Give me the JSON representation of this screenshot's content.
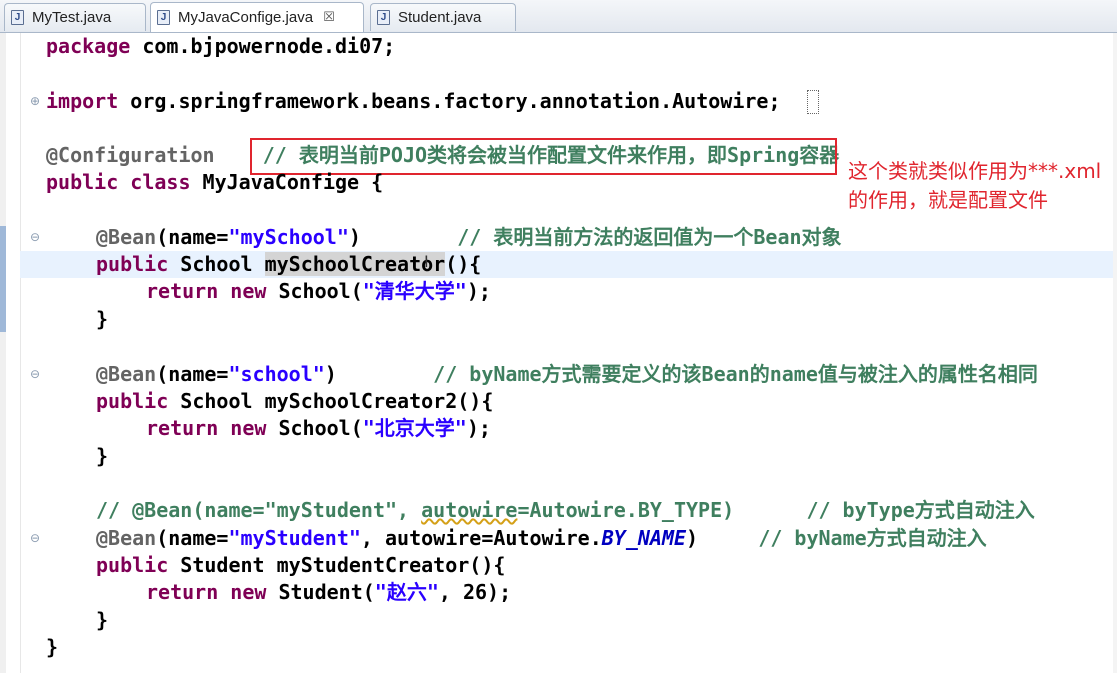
{
  "tabs": [
    {
      "label": "MyTest.java",
      "icon": "java-file-icon",
      "active": false
    },
    {
      "label": "MyJavaConfige.java",
      "icon": "java-file-icon",
      "active": true,
      "close": "☒"
    },
    {
      "label": "Student.java",
      "icon": "java-file-icon",
      "active": false
    }
  ],
  "code": {
    "l1": {
      "kw": "package",
      "rest": " com.bjpowernode.di07;"
    },
    "l3": {
      "kw": "import",
      "rest": " org.springframework.beans.factory.annotation.Autowire;"
    },
    "l5": {
      "ann": "@Configuration",
      "cmt": "// 表明当前POJO类将会被当作配置文件来作用，即Spring容器"
    },
    "l6": {
      "kw1": "public",
      "kw2": "class",
      "rest": " MyJavaConfige {"
    },
    "l8": {
      "ann": "@Bean",
      "p1": "(name=",
      "str": "\"mySchool\"",
      "p2": ")",
      "cmt": "// 表明当前方法的返回值为一个Bean对象"
    },
    "l9": {
      "kw": "public",
      "p1": " School ",
      "method": "mySchoolCreator",
      "p2": "(){"
    },
    "l10": {
      "kw1": "return",
      "kw2": "new",
      "p1": " School(",
      "str": "\"清华大学\"",
      "p2": ");"
    },
    "l11": {
      "text": "}"
    },
    "l13": {
      "ann": "@Bean",
      "p1": "(name=",
      "str": "\"school\"",
      "p2": ")",
      "cmt": "// byName方式需要定义的该Bean的name值与被注入的属性名相同"
    },
    "l14": {
      "kw": "public",
      "rest": " School mySchoolCreator2(){"
    },
    "l15": {
      "kw1": "return",
      "kw2": "new",
      "p1": " School(",
      "str": "\"北京大学\"",
      "p2": ");"
    },
    "l16": {
      "text": "}"
    },
    "l18": {
      "c1": "// @Bean(name=\"myStudent\", ",
      "c2": "autowire",
      "c3": "=Autowire.BY_TYPE)",
      "cmt": "// byType方式自动注入"
    },
    "l19": {
      "ann": "@Bean",
      "p1": "(name=",
      "str": "\"myStudent\"",
      "p2": ", autowire=Autowire.",
      "ital": "BY_NAME",
      "p3": ")",
      "cmt": "// byName方式自动注入"
    },
    "l20": {
      "kw": "public",
      "rest": " Student myStudentCreator(){"
    },
    "l21": {
      "kw1": "return",
      "kw2": "new",
      "p1": " Student(",
      "str": "\"赵六\"",
      "p2": ", 26);"
    },
    "l22": {
      "text": "}"
    },
    "l23": {
      "text": "}"
    }
  },
  "annotation_note": "这个类就类似作用为***.xml的作用，就是配置文件",
  "colors": {
    "keyword": "#7f0055",
    "annotation": "#646464",
    "string": "#2a00ff",
    "comment": "#3f7f5f",
    "highlight_box": "#e0252e"
  }
}
